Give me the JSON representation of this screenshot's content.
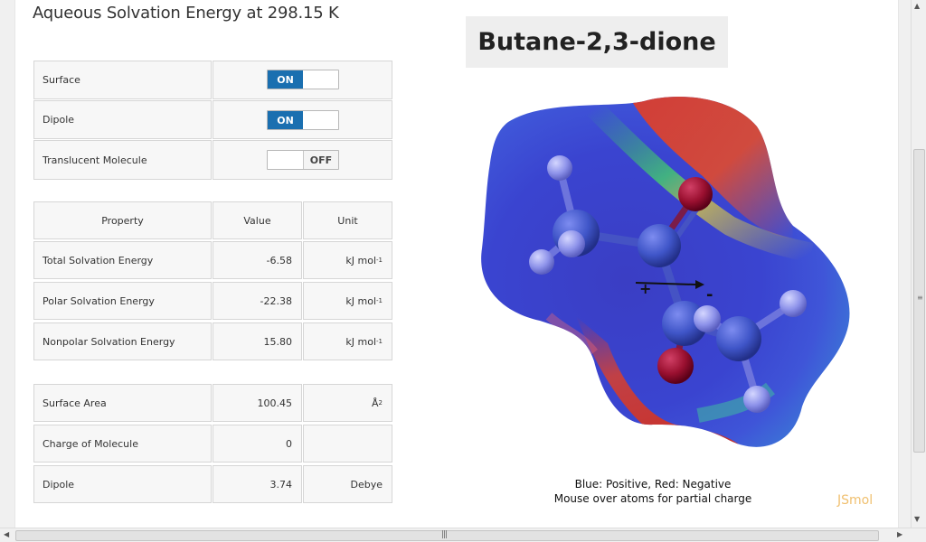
{
  "page": {
    "title": "Aqueous Solvation Energy at 298.15 K"
  },
  "toggles": [
    {
      "label": "Surface",
      "state": "ON"
    },
    {
      "label": "Dipole",
      "state": "ON"
    },
    {
      "label": "Translucent Molecule",
      "state": "OFF"
    }
  ],
  "table": {
    "headers": {
      "property": "Property",
      "value": "Value",
      "unit": "Unit"
    },
    "energy_rows": [
      {
        "property": "Total Solvation Energy",
        "value": "-6.58",
        "unit": "kJ mol",
        "unit_sup": "-1"
      },
      {
        "property": "Polar Solvation Energy",
        "value": "-22.38",
        "unit": "kJ mol",
        "unit_sup": "-1"
      },
      {
        "property": "Nonpolar Solvation Energy",
        "value": "15.80",
        "unit": "kJ mol",
        "unit_sup": "-1"
      }
    ],
    "molecule_rows": [
      {
        "property": "Surface Area",
        "value": "100.45",
        "unit": "Å",
        "unit_sup": "2"
      },
      {
        "property": "Charge of Molecule",
        "value": "0",
        "unit": "",
        "unit_sup": ""
      },
      {
        "property": "Dipole",
        "value": "3.74",
        "unit": "Debye",
        "unit_sup": ""
      }
    ]
  },
  "molecule": {
    "name": "Butane-2,3-dione",
    "legend": "Blue: Positive, Red: Negative",
    "hint": "Mouse over atoms for partial charge",
    "viewer_brand": "JSmol",
    "dipole_plus": "+",
    "dipole_minus": "-"
  },
  "colors": {
    "toggle_on": "#1a6fb0",
    "carbon": "#3f55c8",
    "hydrogen": "#8e93ea",
    "oxygen": "#9a1030"
  }
}
